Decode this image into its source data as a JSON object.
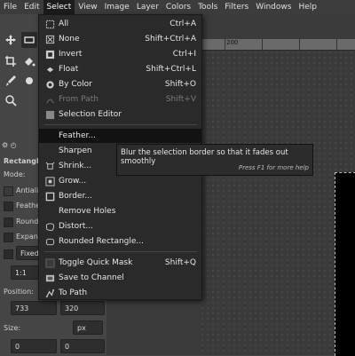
{
  "menubar": {
    "items": [
      "File",
      "Edit",
      "Select",
      "View",
      "Image",
      "Layer",
      "Colors",
      "Tools",
      "Filters",
      "Windows",
      "Help"
    ],
    "active_index": 2
  },
  "select_menu": {
    "items": [
      {
        "label": "All",
        "shortcut": "Ctrl+A",
        "icon": "select-all-icon",
        "disabled": false
      },
      {
        "label": "None",
        "shortcut": "Shift+Ctrl+A",
        "icon": "select-none-icon",
        "disabled": false
      },
      {
        "label": "Invert",
        "shortcut": "Ctrl+I",
        "icon": "invert-icon",
        "disabled": false
      },
      {
        "label": "Float",
        "shortcut": "Shift+Ctrl+L",
        "icon": "float-icon",
        "disabled": false
      },
      {
        "label": "By Color",
        "shortcut": "Shift+O",
        "icon": "by-color-icon",
        "disabled": false
      },
      {
        "label": "From Path",
        "shortcut": "Shift+V",
        "icon": "from-path-icon",
        "disabled": true
      },
      {
        "label": "Selection Editor",
        "shortcut": "",
        "icon": "selection-editor-icon",
        "disabled": false
      },
      {
        "label": "Feather...",
        "shortcut": "",
        "icon": "",
        "disabled": false,
        "hover": true
      },
      {
        "label": "Sharpen",
        "shortcut": "",
        "icon": "",
        "disabled": false
      },
      {
        "label": "Shrink...",
        "shortcut": "",
        "icon": "shrink-icon",
        "disabled": false
      },
      {
        "label": "Grow...",
        "shortcut": "",
        "icon": "grow-icon",
        "disabled": false
      },
      {
        "label": "Border...",
        "shortcut": "",
        "icon": "border-icon",
        "disabled": false
      },
      {
        "label": "Remove Holes",
        "shortcut": "",
        "icon": "",
        "disabled": false
      },
      {
        "label": "Distort...",
        "shortcut": "",
        "icon": "distort-icon",
        "disabled": false
      },
      {
        "label": "Rounded Rectangle...",
        "shortcut": "",
        "icon": "rounded-rect-icon",
        "disabled": false
      },
      {
        "label": "Toggle Quick Mask",
        "shortcut": "Shift+Q",
        "icon": "quick-mask-icon",
        "disabled": false
      },
      {
        "label": "Save to Channel",
        "shortcut": "",
        "icon": "channel-icon",
        "disabled": false
      },
      {
        "label": "To Path",
        "shortcut": "",
        "icon": "to-path-icon",
        "disabled": false
      }
    ]
  },
  "tooltip": {
    "text": "Blur the selection border so that it fades out smoothly",
    "help": "Press F1 for more help"
  },
  "ruler": {
    "label": "200"
  },
  "tool_options": {
    "title": "Rectangle S",
    "mode_label": "Mode:",
    "antialias": "Antiali",
    "feather": "Feather",
    "rounded": "Rounde",
    "expand": "Expand",
    "fixed": "Fixed",
    "ratio": "1:1",
    "position_label": "Position:",
    "pos_x": "733",
    "pos_y": "320",
    "size_label": "Size:",
    "unit": "px",
    "size_w": "0",
    "size_h": "0"
  }
}
